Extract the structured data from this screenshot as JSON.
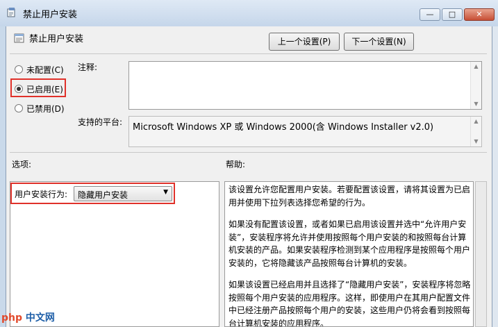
{
  "window": {
    "title": "禁止用户安装",
    "buttons": {
      "minimize": "—",
      "maximize": "□",
      "close": "✕"
    }
  },
  "header": {
    "title": "禁止用户安装",
    "prev_button": "上一个设置(P)",
    "next_button": "下一个设置(N)"
  },
  "state": {
    "options": [
      {
        "label": "未配置(C)",
        "selected": false
      },
      {
        "label": "已启用(E)",
        "selected": true
      },
      {
        "label": "已禁用(D)",
        "selected": false
      }
    ]
  },
  "comment": {
    "label": "注释:",
    "value": ""
  },
  "platform": {
    "label": "支持的平台:",
    "value": "Microsoft Windows XP 或 Windows 2000(含 Windows Installer v2.0)"
  },
  "options_section": {
    "label": "选项:",
    "install_behavior_label": "用户安装行为:",
    "install_behavior_value": "隐藏用户安装"
  },
  "help_section": {
    "label": "帮助:",
    "paragraphs": [
      "该设置允许您配置用户安装。若要配置该设置，请将其设置为已启用并使用下拉列表选择您希望的行为。",
      "如果没有配置该设置，或者如果已启用该设置并选中“允许用户安装”，安装程序将允许并使用按照每个用户安装的和按照每台计算机安装的产品。如果安装程序检测到某个应用程序是按照每个用户安装的，它将隐藏该产品按照每台计算机的安装。",
      "如果该设置已经启用并且选择了“隐藏用户安装”，安装程序将忽略按照每个用户安装的应用程序。这样，即使用户在其用户配置文件中已经注册产品按照每个用户的安装，这些用户仍将会看到按照每台计算机安装的应用程序。"
    ]
  },
  "watermark": {
    "brand": "php",
    "text": "中文网"
  },
  "colors": {
    "highlight": "#e0312a",
    "titlebar": "#c5d6ea"
  }
}
